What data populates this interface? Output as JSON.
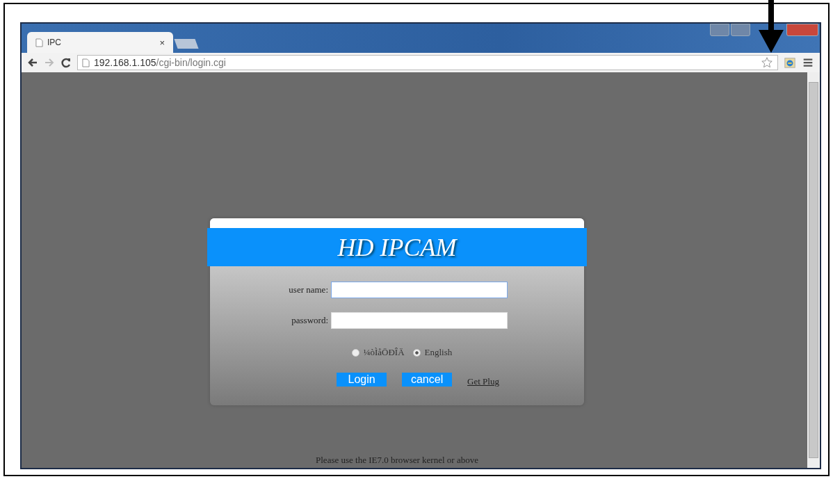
{
  "tab": {
    "title": "IPC",
    "close": "×"
  },
  "address_bar": {
    "host": "192.168.1.105",
    "path": "/cgi-bin/login.cgi"
  },
  "login": {
    "title": "HD IPCAM",
    "fields": [
      {
        "label": "user name:",
        "focused": true
      },
      {
        "label": "password:",
        "focused": false
      }
    ],
    "languages": [
      {
        "label": "¼òÌåÖÐÎÄ",
        "selected": false
      },
      {
        "label": "English",
        "selected": true
      }
    ],
    "buttons": [
      {
        "label": "Login"
      },
      {
        "label": "cancel"
      }
    ],
    "link": "Get Plug"
  },
  "notice": "Please use the IE7.0 browser kernel or above"
}
